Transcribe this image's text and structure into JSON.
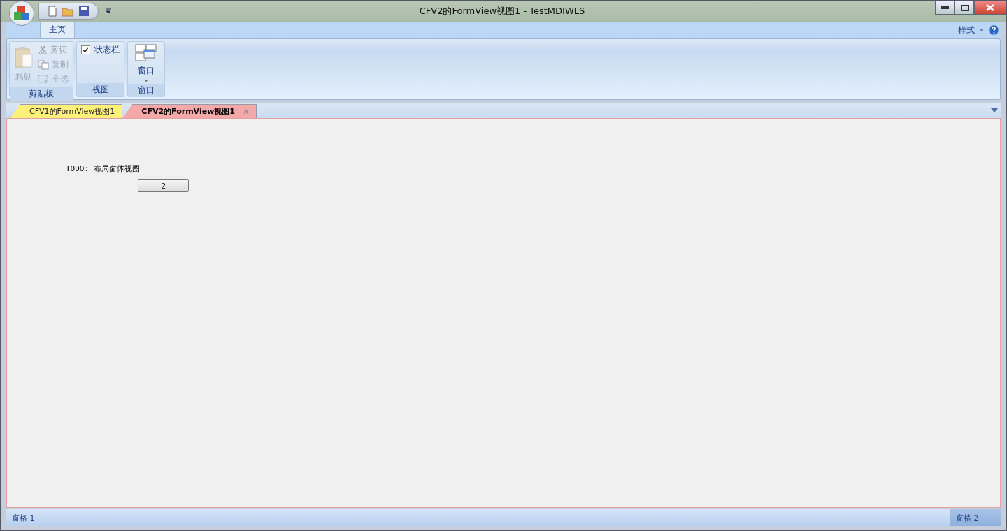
{
  "window": {
    "title": "CFV2的FormView视图1 - TestMDIWLS"
  },
  "ribbon": {
    "tabs": [
      {
        "label": "主页",
        "selected": true
      }
    ],
    "style_menu": "样式",
    "groups": [
      {
        "caption": "剪贴板",
        "kind": "clipboard",
        "large": {
          "label": "粘贴",
          "disabled": true
        },
        "items": [
          {
            "label": "剪切",
            "disabled": true
          },
          {
            "label": "复制",
            "disabled": true
          },
          {
            "label": "全选",
            "disabled": true
          }
        ]
      },
      {
        "caption": "视图",
        "kind": "checks",
        "items": [
          {
            "label": "状态栏",
            "checked": true
          }
        ]
      },
      {
        "caption": "窗口",
        "kind": "window",
        "large": {
          "label": "窗口",
          "disabled": false
        }
      }
    ]
  },
  "mdi_tabs": [
    {
      "label": "CFV1的FormView视图1",
      "selected": false,
      "color": "#fff07a"
    },
    {
      "label": "CFV2的FormView视图1",
      "selected": true,
      "color": "#f4a8a8"
    }
  ],
  "form": {
    "text": "TODO: 布局窗体视图",
    "button": "2"
  },
  "status_bar": {
    "panes": [
      {
        "text": "窗格 1",
        "selected": false
      },
      {
        "text": "窗格 2",
        "selected": true
      }
    ]
  }
}
